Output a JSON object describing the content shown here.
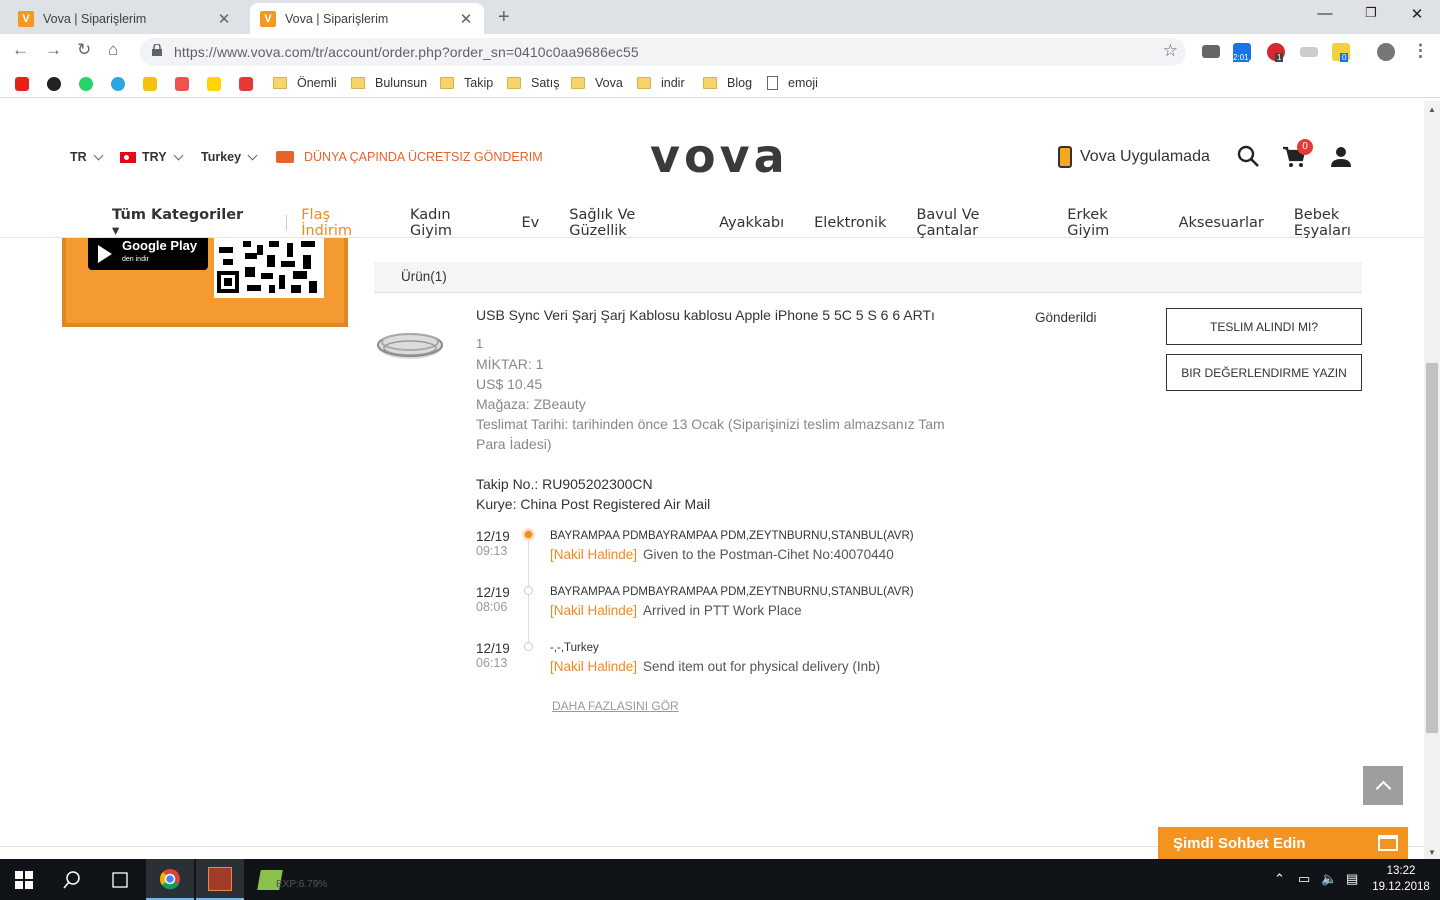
{
  "browser": {
    "tabs": [
      {
        "title": "Vova | Siparişlerim",
        "favicon": "V"
      },
      {
        "title": "Vova | Siparişlerim",
        "favicon": "V"
      }
    ],
    "url": "https://www.vova.com/tr/account/order.php?order_sn=0410c0aa9686ec55",
    "ext_badges": {
      "clock": "2:01",
      "opera": "1",
      "notes": "0"
    },
    "bookmarks": [
      "Önemli",
      "Bulunsun",
      "Takip",
      "Satış",
      "Vova",
      "indir",
      "Blog",
      "emoji"
    ]
  },
  "header": {
    "lang": "TR",
    "currency": "TRY",
    "country": "Turkey",
    "shipping": "DÜNYA ÇAPINDA ÜCRETSIZ GÖNDERIM",
    "logo": "vova",
    "app_link": "Vova Uygulamada",
    "cart_count": "0"
  },
  "categories": {
    "all": "Tüm Kategoriler",
    "items": [
      "Flaş İndirim",
      "Kadın Giyim",
      "Ev",
      "Sağlık Ve Güzellik",
      "Ayakkabı",
      "Elektronik",
      "Bavul Ve Çantalar",
      "Erkek Giyim",
      "Aksesuarlar",
      "Bebek Eşyaları"
    ]
  },
  "banner": {
    "store": "Google Play",
    "store_sub": "den indir"
  },
  "product": {
    "section_title": "Ürün(1)",
    "title": "USB Sync Veri Şarj Şarj Kablosu kablosu Apple iPhone 5 5C 5 S 6 6 ARTı",
    "variant": "1",
    "quantity": "MİKTAR: 1",
    "price": "US$ 10.45",
    "store": "Mağaza: ZBeauty",
    "delivery_line1": "Teslimat Tarihi: tarihinden önce 13 Ocak (Siparişinizi teslim almazsanız Tam",
    "delivery_line2": "Para İadesi)",
    "tracking": "Takip No.: RU905202300CN",
    "courier": "Kurye: China Post Registered Air Mail",
    "status": "Gönderildi",
    "btn_received": "TESLIM ALINDI MI?",
    "btn_review": "BIR DEĞERLENDIRME YAZIN"
  },
  "timeline": [
    {
      "date": "12/19",
      "time": "09:13",
      "location": "BAYRAMPAA PDMBAYRAMPAA PDM,ZEYTNBURNU,STANBUL(AVR)",
      "status": "[Nakil Halinde]",
      "event": "Given to the Postman-Cihet No:40070440"
    },
    {
      "date": "12/19",
      "time": "08:06",
      "location": "BAYRAMPAA PDMBAYRAMPAA PDM,ZEYTNBURNU,STANBUL(AVR)",
      "status": "[Nakil Halinde]",
      "event": "Arrived in PTT Work Place"
    },
    {
      "date": "12/19",
      "time": "06:13",
      "location": "-,-,Turkey",
      "status": "[Nakil Halinde]",
      "event": "Send item out for physical delivery (Inb)"
    }
  ],
  "more_link": "DAHA FAZLASINI GÖR",
  "chat": "Şimdi Sohbet Edin",
  "taskbar": {
    "time": "13:22",
    "date": "19.12.2018",
    "game_overlay": "EXP:6.79%"
  },
  "colors": {
    "accent": "#f08a24",
    "chat": "#f39421"
  }
}
